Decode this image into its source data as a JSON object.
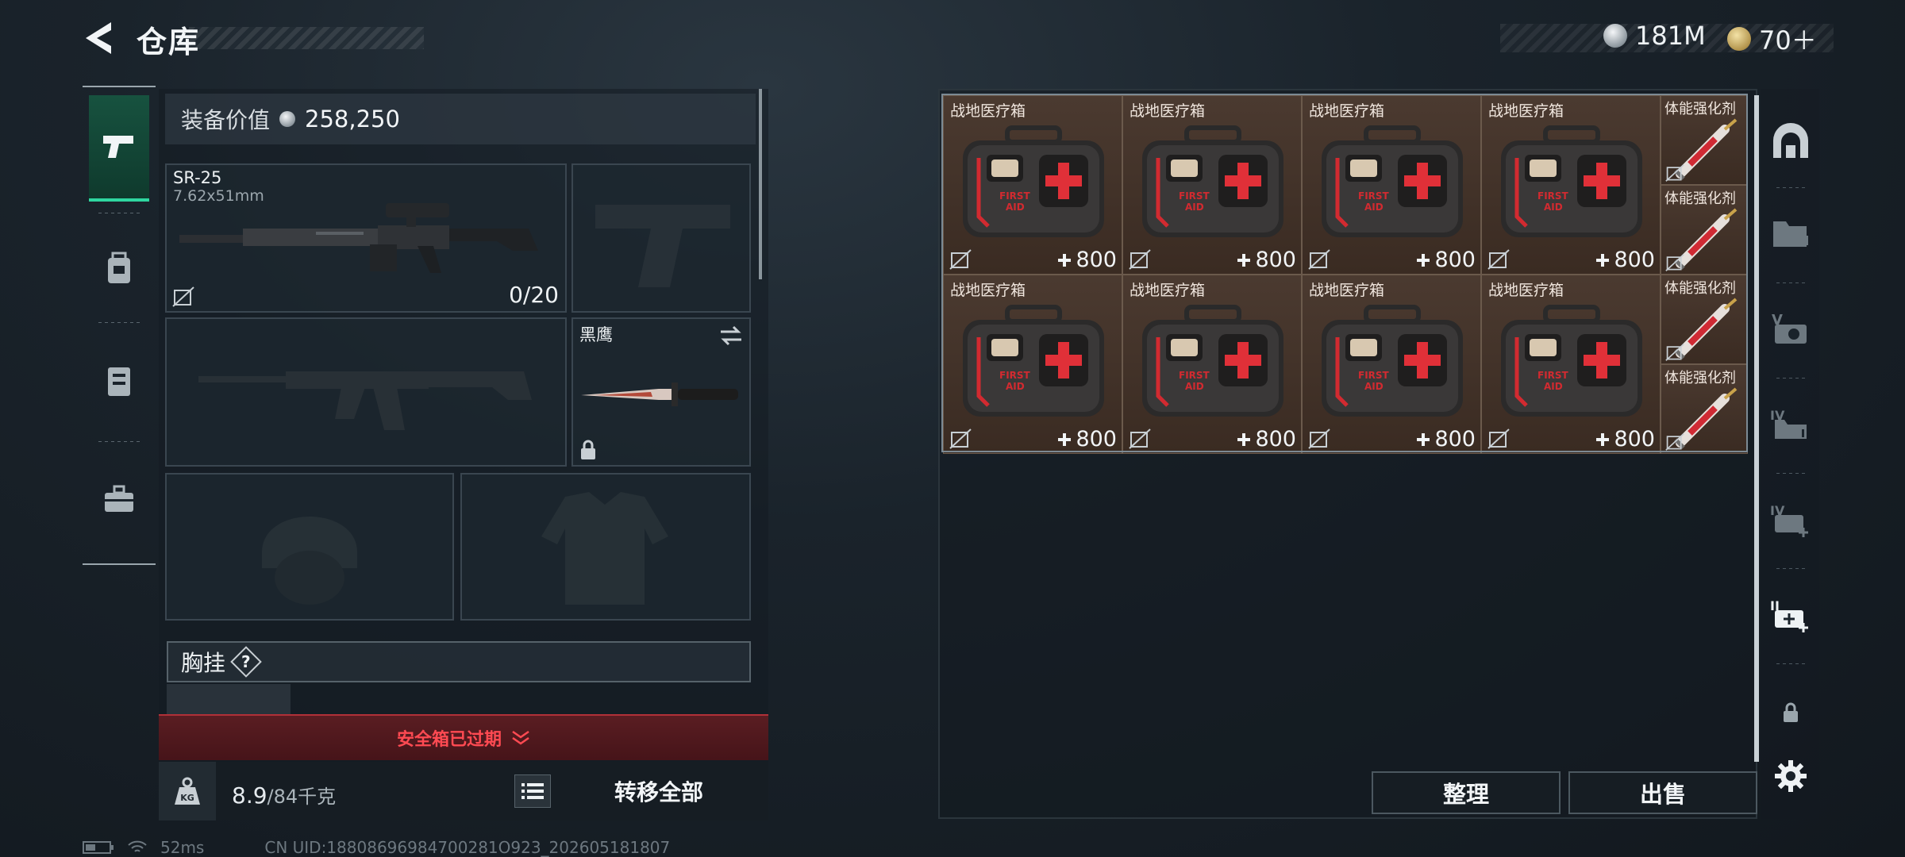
{
  "header": {
    "title": "仓库"
  },
  "currency": [
    {
      "icon": "silver-coin-icon",
      "value": "181M"
    },
    {
      "icon": "gold-coin-icon",
      "value": "70＋"
    }
  ],
  "equipment": {
    "value_label": "装备价值",
    "value": "258,250",
    "primary_weapon": {
      "name": "SR-25",
      "caliber": "7.62x51mm",
      "ammo": "0/20"
    },
    "melee": {
      "name": "黑鹰"
    },
    "chest_rig_label": "胸挂",
    "help": "?",
    "safe_box_status": "安全箱已过期",
    "weight": {
      "current": "8.9",
      "capacity": "/84千克"
    },
    "transfer_all": "转移全部"
  },
  "storage": {
    "items": [
      {
        "name": "战地医疗箱",
        "count": "800"
      },
      {
        "name": "战地医疗箱",
        "count": "800"
      },
      {
        "name": "战地医疗箱",
        "count": "800"
      },
      {
        "name": "战地医疗箱",
        "count": "800"
      },
      {
        "name": "战地医疗箱",
        "count": "800"
      },
      {
        "name": "战地医疗箱",
        "count": "800"
      },
      {
        "name": "战地医疗箱",
        "count": "800"
      },
      {
        "name": "战地医疗箱",
        "count": "800"
      }
    ],
    "small_items": [
      {
        "name": "体能强化剂"
      },
      {
        "name": "体能强化剂"
      },
      {
        "name": "体能强化剂"
      },
      {
        "name": "体能强化剂"
      }
    ],
    "sort_label": "整理",
    "sell_label": "出售"
  },
  "status": {
    "ping": "52ms",
    "uid": "CN UID:18808696984700281O923_202605181807"
  },
  "colors": {
    "accent": "#2fd6a0",
    "warning": "#ff4a52",
    "item_bg": "#4b3a30"
  }
}
